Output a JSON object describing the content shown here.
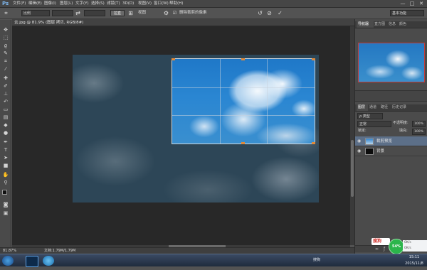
{
  "app": {
    "logo": "Ps"
  },
  "menu": [
    "文件(F)",
    "编辑(E)",
    "图像(I)",
    "图层(L)",
    "文字(Y)",
    "选择(S)",
    "滤镜(T)",
    "3D(D)",
    "视图(V)",
    "窗口(W)",
    "帮助(H)"
  ],
  "window_controls": [
    "—",
    "□",
    "✕"
  ],
  "options_bar": {
    "ratio_select": "比例",
    "straighten_btn": "拉直",
    "view_label": "视图",
    "delete_checkbox_label": "删除裁剪的像素",
    "workspace_select": "基本功能"
  },
  "document_tab": {
    "title": "云.jpg @ 81.9% (图层 拷贝, RGB/8#)"
  },
  "status_bar": {
    "zoom": "81.87%",
    "doc_info": "文档:1.79M/1.79M"
  },
  "panels": {
    "navigator_tabs": [
      "导航器",
      "直方图",
      "信息",
      "颜色"
    ],
    "layers_tabs": [
      "图层",
      "通道",
      "路径",
      "历史记录"
    ],
    "filter_label": "ρ 类型",
    "blend_mode": "正常",
    "opacity_label": "不透明度:",
    "opacity_value": "100%",
    "lock_label": "锁定:",
    "fill_label": "填充:",
    "fill_value": "100%",
    "layers": [
      {
        "name": "裁剪预览",
        "selected": true
      },
      {
        "name": "背景",
        "selected": false
      }
    ]
  },
  "taskbar": {
    "clock_time": "15:11",
    "clock_date": "2015/11/8",
    "speed_percent": "54%",
    "net_up": "0K/s",
    "net_down": "0K/s",
    "tray_text": "搜狗"
  },
  "icons": {
    "move": "move-icon",
    "marquee": "marquee-icon",
    "lasso": "lasso-icon",
    "quick-select": "magic-wand-icon",
    "crop": "crop-icon",
    "eyedropper": "eyedropper-icon",
    "heal": "healing-brush-icon",
    "brush": "brush-icon",
    "stamp": "clone-stamp-icon",
    "history": "history-brush-icon",
    "eraser": "eraser-icon",
    "gradient": "gradient-icon",
    "blur": "blur-icon",
    "dodge": "dodge-icon",
    "pen": "pen-icon",
    "type": "type-icon",
    "path": "path-select-icon",
    "shape": "rectangle-icon",
    "hand": "hand-icon",
    "zoom": "zoom-icon"
  },
  "colors": {
    "crop_handle": "#e08a3a",
    "accent_blue": "#2a86d2",
    "nav_frame": "#c23b3b"
  }
}
